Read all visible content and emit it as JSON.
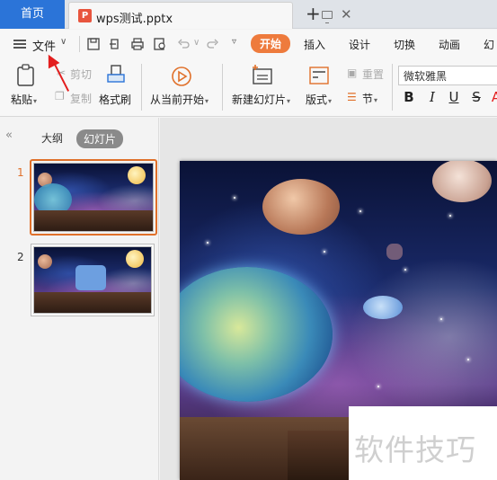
{
  "tabs": {
    "home": "首页",
    "document": "wps测试.pptx"
  },
  "menu": {
    "file": "文件"
  },
  "ribbon_tabs": [
    "开始",
    "插入",
    "设计",
    "切换",
    "动画",
    "幻"
  ],
  "ribbon": {
    "paste": "粘贴",
    "cut": "剪切",
    "copy": "复制",
    "format_painter": "格式刷",
    "from_current": "从当前开始",
    "new_slide": "新建幻灯片",
    "layout": "版式",
    "reset": "重置",
    "section": "节",
    "font_name": "微软雅黑",
    "bold": "B",
    "italic": "I",
    "underline": "U",
    "strike": "S"
  },
  "panel": {
    "outline": "大纲",
    "slides": "幻灯片",
    "slide_numbers": [
      "1",
      "2"
    ]
  },
  "watermark": "软件技巧",
  "colors": {
    "home_tab": "#2b74d8",
    "accent": "#ee7b3d",
    "arrow": "#e31e1e"
  }
}
